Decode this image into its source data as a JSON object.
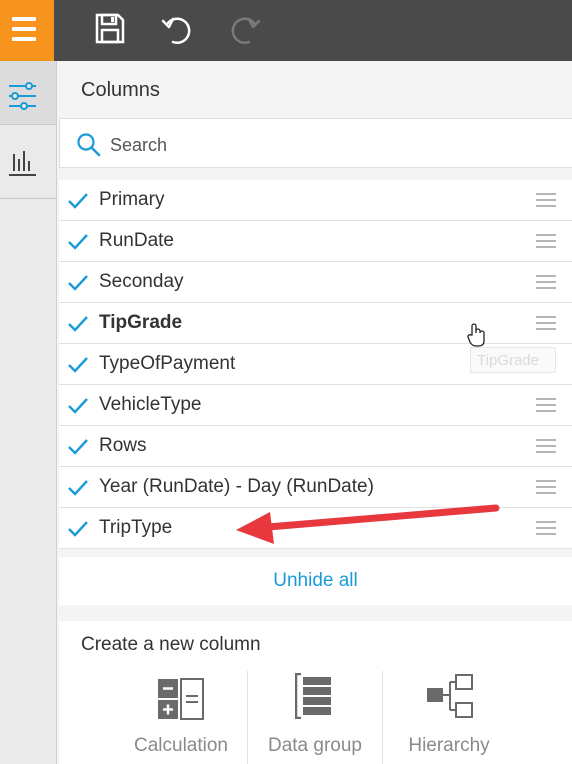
{
  "toolbar": {
    "menu_icon": "hamburger-icon",
    "buttons": [
      {
        "icon": "save-icon",
        "enabled": true
      },
      {
        "icon": "undo-icon",
        "enabled": true
      },
      {
        "icon": "redo-icon",
        "enabled": false
      }
    ]
  },
  "sidebar": {
    "items": [
      {
        "icon": "sliders-icon",
        "active": true
      },
      {
        "icon": "bar-chart-icon",
        "active": false
      }
    ]
  },
  "columns_panel": {
    "title": "Columns",
    "search": {
      "placeholder": "Search",
      "value": ""
    },
    "items": [
      {
        "label": "Primary",
        "checked": true
      },
      {
        "label": "RunDate",
        "checked": true
      },
      {
        "label": "Seconday",
        "checked": true
      },
      {
        "label": "TipGrade",
        "checked": true,
        "hovered": true
      },
      {
        "label": "TypeOfPayment",
        "checked": true
      },
      {
        "label": "VehicleType",
        "checked": true
      },
      {
        "label": "Rows",
        "checked": true
      },
      {
        "label": "Year (RunDate) - Day (RunDate)",
        "checked": true
      },
      {
        "label": "TripType",
        "checked": true
      }
    ],
    "tooltip": "TipGrade",
    "unhide_all": "Unhide all"
  },
  "create_column": {
    "title": "Create a new column",
    "options": [
      {
        "label": "Calculation",
        "icon": "calculator-icon"
      },
      {
        "label": "Data group",
        "icon": "data-group-icon"
      },
      {
        "label": "Hierarchy",
        "icon": "hierarchy-icon"
      }
    ]
  },
  "colors": {
    "topbar": "#4a4a4a",
    "menu_accent": "#f7941d",
    "check_accent": "#1a9bd7",
    "link": "#1a9bd7",
    "annotation_arrow": "#e8383d"
  }
}
